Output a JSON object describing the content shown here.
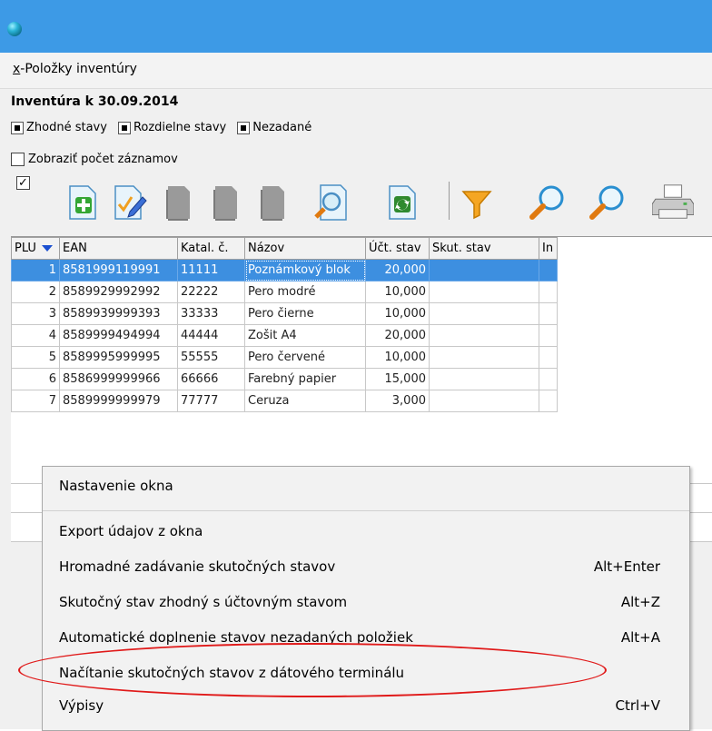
{
  "menu": {
    "hotkey": "x",
    "title": "-Položky inventúry"
  },
  "inventory_title": "Inventúra k 30.09.2014",
  "filters": [
    "Zhodné stavy",
    "Rozdielne stavy",
    "Nezadané"
  ],
  "show_count_label": "Zobraziť počet záznamov",
  "toolbar_icons": [
    "add-icon",
    "edit-icon",
    "copy-disabled-icon",
    "delete-disabled-icon",
    "preview-icon",
    "refresh-icon",
    "filter-icon",
    "find-icon",
    "find-next-icon",
    "print-icon"
  ],
  "table": {
    "columns": [
      "PLU",
      "EAN",
      "Katal. č.",
      "Názov",
      "Účt. stav",
      "Skut. stav",
      "In"
    ],
    "rows": [
      {
        "plu": "1",
        "ean": "8581999119991",
        "katal": "11111",
        "nazov": "Poznámkový blok",
        "uct": "20,000",
        "skut": ""
      },
      {
        "plu": "2",
        "ean": "8589929992992",
        "katal": "22222",
        "nazov": "Pero modré",
        "uct": "10,000",
        "skut": ""
      },
      {
        "plu": "3",
        "ean": "8589939999393",
        "katal": "33333",
        "nazov": "Pero čierne",
        "uct": "10,000",
        "skut": ""
      },
      {
        "plu": "4",
        "ean": "8589999494994",
        "katal": "44444",
        "nazov": "Zošit A4",
        "uct": "20,000",
        "skut": ""
      },
      {
        "plu": "5",
        "ean": "8589995999995",
        "katal": "55555",
        "nazov": "Pero červené",
        "uct": "10,000",
        "skut": ""
      },
      {
        "plu": "6",
        "ean": "8586999999966",
        "katal": "66666",
        "nazov": "Farebný papier",
        "uct": "15,000",
        "skut": ""
      },
      {
        "plu": "7",
        "ean": "8589999999979",
        "katal": "77777",
        "nazov": "Ceruza",
        "uct": "3,000",
        "skut": ""
      }
    ]
  },
  "context_menu": {
    "items": [
      {
        "label": "Nastavenie okna",
        "shortcut": ""
      },
      {
        "label": "Export údajov z okna",
        "shortcut": ""
      },
      {
        "label": "Hromadné zadávanie skutočných stavov",
        "shortcut": "Alt+Enter"
      },
      {
        "label": "Skutočný stav zhodný s účtovným stavom",
        "shortcut": "Alt+Z"
      },
      {
        "label": "Automatické doplnenie stavov nezadaných položiek",
        "shortcut": "Alt+A"
      },
      {
        "label": "Načítanie skutočných stavov z dátového terminálu",
        "shortcut": ""
      },
      {
        "label": "Výpisy",
        "shortcut": "Ctrl+V"
      }
    ]
  },
  "colors": {
    "titlebar": "#3d9ae6",
    "selection": "#3d8fe0",
    "highlight_ellipse": "#e01a1a"
  }
}
